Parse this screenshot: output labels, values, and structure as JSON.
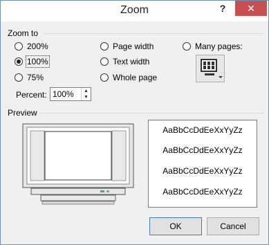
{
  "window": {
    "title": "Zoom",
    "help": "?",
    "close": "✕"
  },
  "zoom_to": {
    "label": "Zoom to",
    "options": [
      {
        "label": "200%",
        "selected": false
      },
      {
        "label": "100%",
        "selected": true
      },
      {
        "label": "75%",
        "selected": false
      },
      {
        "label": "Page width",
        "selected": false
      },
      {
        "label": "Text width",
        "selected": false
      },
      {
        "label": "Whole page",
        "selected": false
      },
      {
        "label": "Many pages:",
        "selected": false
      }
    ],
    "percent_label": "Percent:",
    "percent_value": "100%"
  },
  "preview": {
    "label": "Preview",
    "samples": [
      "AaBbCcDdEeXxYyZz",
      "AaBbCcDdEeXxYyZz",
      "AaBbCcDdEeXxYyZz",
      "AaBbCcDdEeXxYyZz"
    ]
  },
  "buttons": {
    "ok": "OK",
    "cancel": "Cancel"
  },
  "icons": {
    "many_pages": "monitor-pages-icon",
    "spin_up": "▲",
    "spin_down": "▼"
  }
}
